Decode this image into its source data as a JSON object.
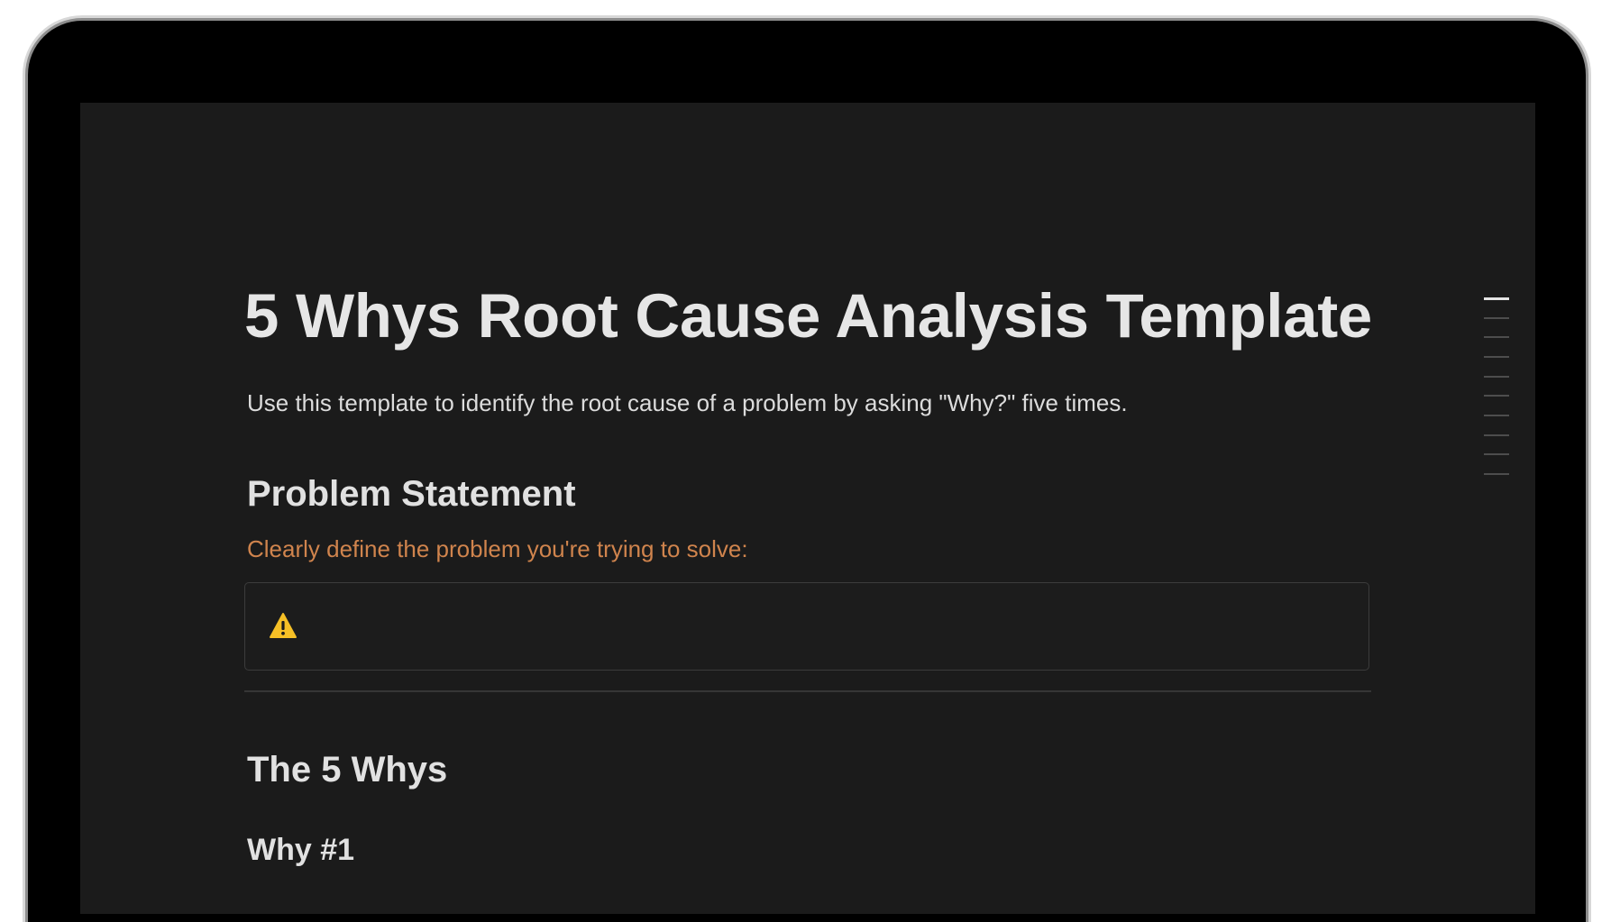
{
  "document": {
    "title": "5 Whys Root Cause Analysis Template",
    "intro": "Use this template to identify the root cause of a problem by asking \"Why?\" five times.",
    "sections": {
      "problem": {
        "heading": "Problem Statement",
        "prompt": "Clearly define the problem you're trying to solve:",
        "callout_icon": "warning-icon",
        "callout_text": ""
      },
      "whys": {
        "heading": "The 5 Whys",
        "first_subheading": "Why #1"
      }
    }
  },
  "outline": {
    "active_index": 0,
    "item_count": 10
  },
  "colors": {
    "background": "#1b1b1b",
    "text": "#e6e6e6",
    "accent_orange": "#d0844d",
    "warning": "#f6c026",
    "border": "#3c3c3c"
  }
}
